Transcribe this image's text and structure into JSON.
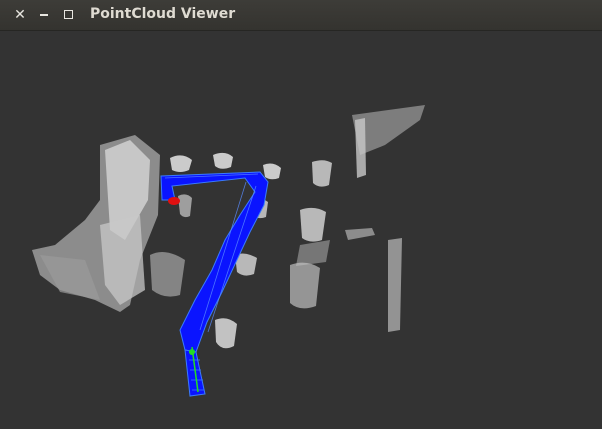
{
  "window": {
    "title": "PointCloud Viewer",
    "controls": [
      "close",
      "minimize",
      "maximize"
    ]
  },
  "icons": {
    "close": "close-icon",
    "minimize": "minimize-icon",
    "maximize": "maximize-icon"
  },
  "colors": {
    "background": "#333333",
    "trajectory": "#0a14ff",
    "trajectory_edge": "#3a7bff",
    "start_marker": "#22dd22",
    "end_marker": "#e01010",
    "point_cloud": "#d8d8d8"
  }
}
